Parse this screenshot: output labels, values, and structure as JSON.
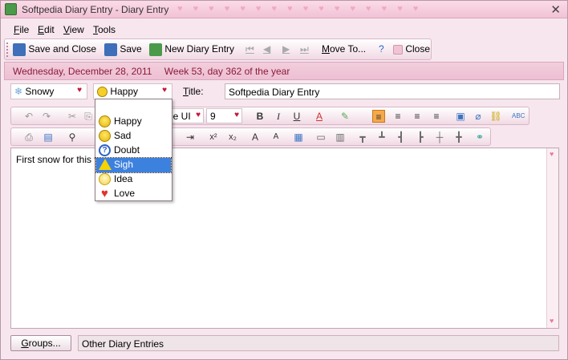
{
  "window": {
    "title": "Softpedia Diary Entry - Diary Entry"
  },
  "menu": [
    "File",
    "Edit",
    "View",
    "Tools"
  ],
  "toolbar": {
    "save_close": "Save and Close",
    "save": "Save",
    "new_entry": "New Diary Entry",
    "move_to": "Move To...",
    "close": "Close"
  },
  "datebar": {
    "date": "Wednesday, December 28, 2011",
    "week": "Week 53, day 362 of the year"
  },
  "entry": {
    "weather": "Snowy",
    "mood": "Happy",
    "title_label": "Title:",
    "title_value": "Softpedia Diary Entry"
  },
  "format": {
    "font": "pe UI",
    "size": "9"
  },
  "mood_options": [
    "Happy",
    "Sad",
    "Doubt",
    "Sigh",
    "Idea",
    "Love"
  ],
  "mood_selected": "Sigh",
  "editor": {
    "text": "First snow for this w"
  },
  "footer": {
    "groups_label": "Groups...",
    "other_entries": "Other Diary Entries"
  },
  "colors": {
    "accent": "#8b1a3a",
    "selection": "#3d81de",
    "heart": "#c3163a"
  }
}
